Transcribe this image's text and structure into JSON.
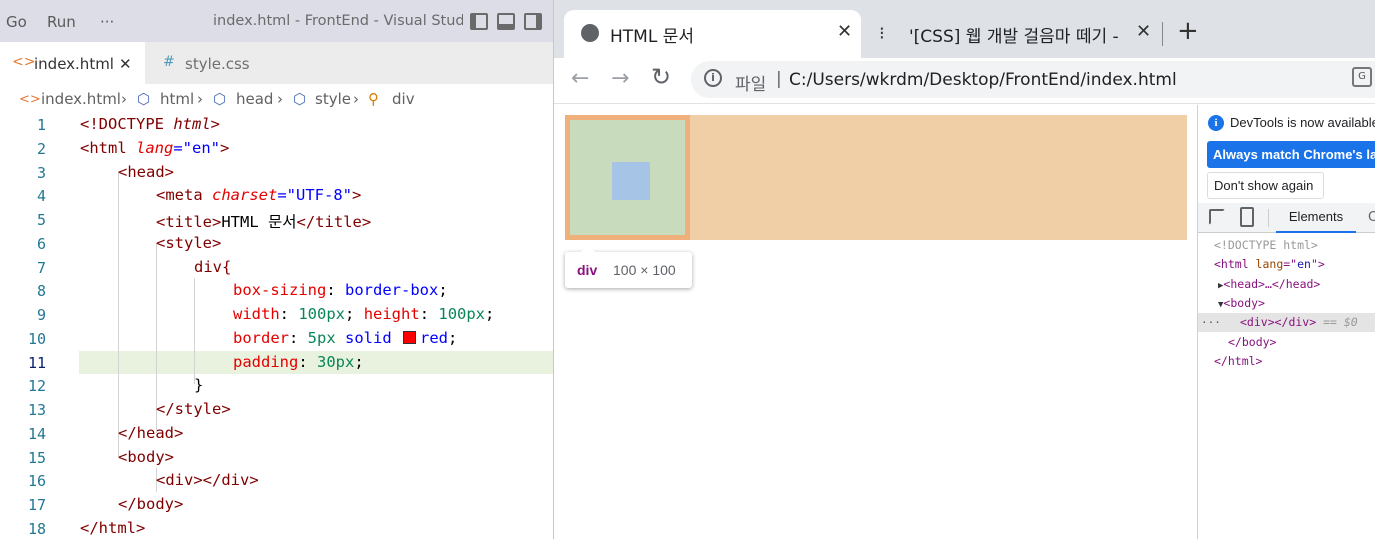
{
  "vscode": {
    "menu": [
      "Go",
      "Run",
      "···"
    ],
    "window_title": "index.html - FrontEnd - Visual Studi...",
    "tabs": [
      {
        "icon": "<>",
        "label": "index.html",
        "close": "✕"
      },
      {
        "icon": "#",
        "label": "style.css"
      }
    ],
    "breadcrumb": [
      "index.html",
      "html",
      "head",
      "style",
      "div"
    ],
    "line_numbers": [
      "1",
      "2",
      "3",
      "4",
      "5",
      "6",
      "7",
      "8",
      "9",
      "10",
      "11",
      "12",
      "13",
      "14",
      "15",
      "16",
      "17",
      "18"
    ],
    "code": {
      "l1a": "<!DOCTYPE ",
      "l1b": "html",
      "l1c": ">",
      "l2a": "<html ",
      "l2b": "lang",
      "l2c": "=\"en\"",
      "l2d": ">",
      "l3": "<head>",
      "l4a": "<meta ",
      "l4b": "charset",
      "l4c": "=\"UTF-8\"",
      "l4d": ">",
      "l5a": "<title>",
      "l5b": "HTML 문서",
      "l5c": "</title>",
      "l6": "<style>",
      "l7": "div{",
      "l8a": "box-sizing",
      "l8b": ": ",
      "l8c": "border-box",
      "l8d": ";",
      "l9a": "width",
      "l9b": ": ",
      "l9c": "100px",
      "l9d": "; ",
      "l9e": "height",
      "l9f": ": ",
      "l9g": "100px",
      "l9h": ";",
      "l10a": "border",
      "l10b": ": ",
      "l10c": "5px",
      "l10d": " solid ",
      "l10e": "red",
      "l10f": ";",
      "l11a": "padding",
      "l11b": ": ",
      "l11c": "30px",
      "l11d": ";",
      "l12": "}",
      "l13": "</style>",
      "l14": "</head>",
      "l15": "<body>",
      "l16": "<div></div>",
      "l17": "</body>",
      "l18": "</html>"
    }
  },
  "chrome": {
    "tabs": [
      {
        "title": "HTML 문서",
        "close": "✕"
      },
      {
        "title": "'[CSS] 웹 개발 걸음마 떼기 -",
        "close": "✕"
      }
    ],
    "new_tab": "+",
    "nav": {
      "back": "←",
      "forward": "→",
      "reload": "↻"
    },
    "address": {
      "scheme": "파일",
      "url": "C:/Users/wkrdm/Desktop/FrontEnd/index.html"
    },
    "tooltip": {
      "tag": "div",
      "size": "100 × 100"
    },
    "colors": {
      "margin": "#f0cfa6",
      "border": "#f0b07b",
      "padding": "#c8dcbd",
      "content": "#a6c4e6"
    }
  },
  "devtools": {
    "notice": "DevTools is now available in",
    "primary_button": "Always match Chrome's language",
    "secondary_button": "Don't show again",
    "tabs": {
      "elements": "Elements",
      "console": "Co"
    },
    "dom": {
      "doctype": "<!DOCTYPE html>",
      "html_open_a": "<html ",
      "html_attr": "lang",
      "html_eq": "=\"",
      "html_val": "en",
      "html_close": "\">",
      "head": "<head>…</head>",
      "body_open": "<body>",
      "div": "<div></div>",
      "selected_suffix": " == $0",
      "body_close": "</body>",
      "html_end": "</html>",
      "ellipsis": "···"
    }
  }
}
